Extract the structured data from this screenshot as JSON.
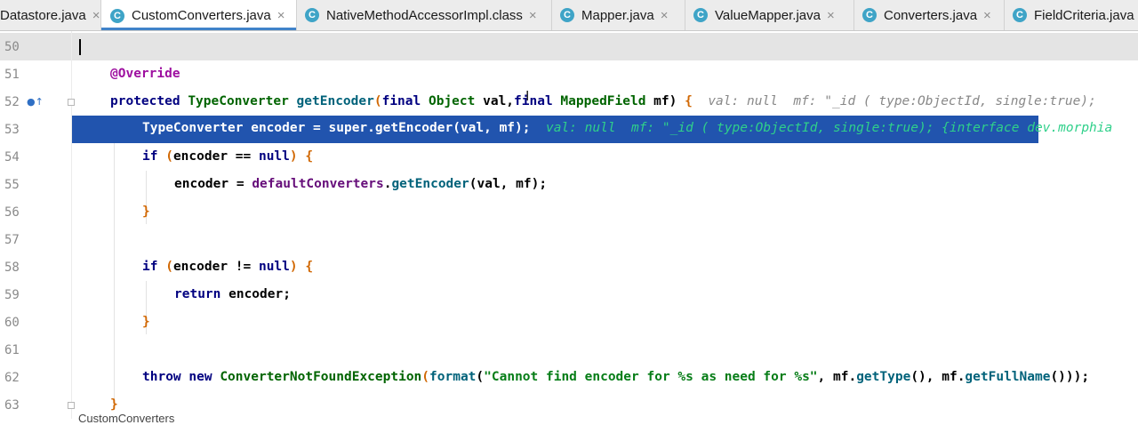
{
  "tabs": [
    {
      "label": "Datastore.java",
      "icon": "C"
    },
    {
      "label": "CustomConverters.java",
      "icon": "C"
    },
    {
      "label": "NativeMethodAccessorImpl.class",
      "icon": "C"
    },
    {
      "label": "Mapper.java",
      "icon": "C"
    },
    {
      "label": "ValueMapper.java",
      "icon": "C"
    },
    {
      "label": "Converters.java",
      "icon": "C"
    },
    {
      "label": "FieldCriteria.java",
      "icon": "C"
    }
  ],
  "active_tab": "CustomConverters.java",
  "close_glyph": "×",
  "line_numbers": [
    "50",
    "51",
    "52",
    "53",
    "54",
    "55",
    "56",
    "57",
    "58",
    "59",
    "60",
    "61",
    "62",
    "63"
  ],
  "code": {
    "l51": {
      "a": "@Override"
    },
    "l52": {
      "protected": "protected",
      "type": "TypeConverter",
      "method": "getEncoder",
      "paren": "(",
      "final1": "final",
      "obj": "Object",
      "val": " val,",
      "final2": "final",
      "mf_type": "MappedField",
      "mf": " mf) ",
      "brace": "{",
      "hint": "val: null  mf: \"_id ( type:ObjectId, single:true);"
    },
    "l53": {
      "text": "TypeConverter encoder = super.getEncoder(val, mf);",
      "hint": "val: null  mf: \"_id ( type:ObjectId, single:true); {interface dev.morphia"
    },
    "l54": {
      "if": "if",
      "open": " (",
      "cond": "encoder == ",
      "null": "null",
      "close": ") ",
      "brace": "{"
    },
    "l55": {
      "pre": "encoder = ",
      "field": "defaultConverters",
      "dot": ".",
      "method": "getEncoder",
      "args": "(val, mf);"
    },
    "l56": {
      "brace": "}"
    },
    "l58": {
      "if": "if",
      "open": " (",
      "cond": "encoder != ",
      "null": "null",
      "close": ") ",
      "brace": "{"
    },
    "l59": {
      "ret": "return",
      "rest": " encoder;"
    },
    "l60": {
      "brace": "}"
    },
    "l62": {
      "throw": "throw",
      "new": " new ",
      "cls": "ConverterNotFoundException",
      "p1": "(",
      "fmt": "format",
      "p2": "(",
      "str": "\"Cannot find encoder for %s as need for %s\"",
      "c1": ", mf.",
      "m1": "getType",
      "c2": "(), mf.",
      "m2": "getFullName",
      "c3": "()));"
    },
    "l63": {
      "brace": "}"
    }
  },
  "breadcrumb": "CustomConverters"
}
